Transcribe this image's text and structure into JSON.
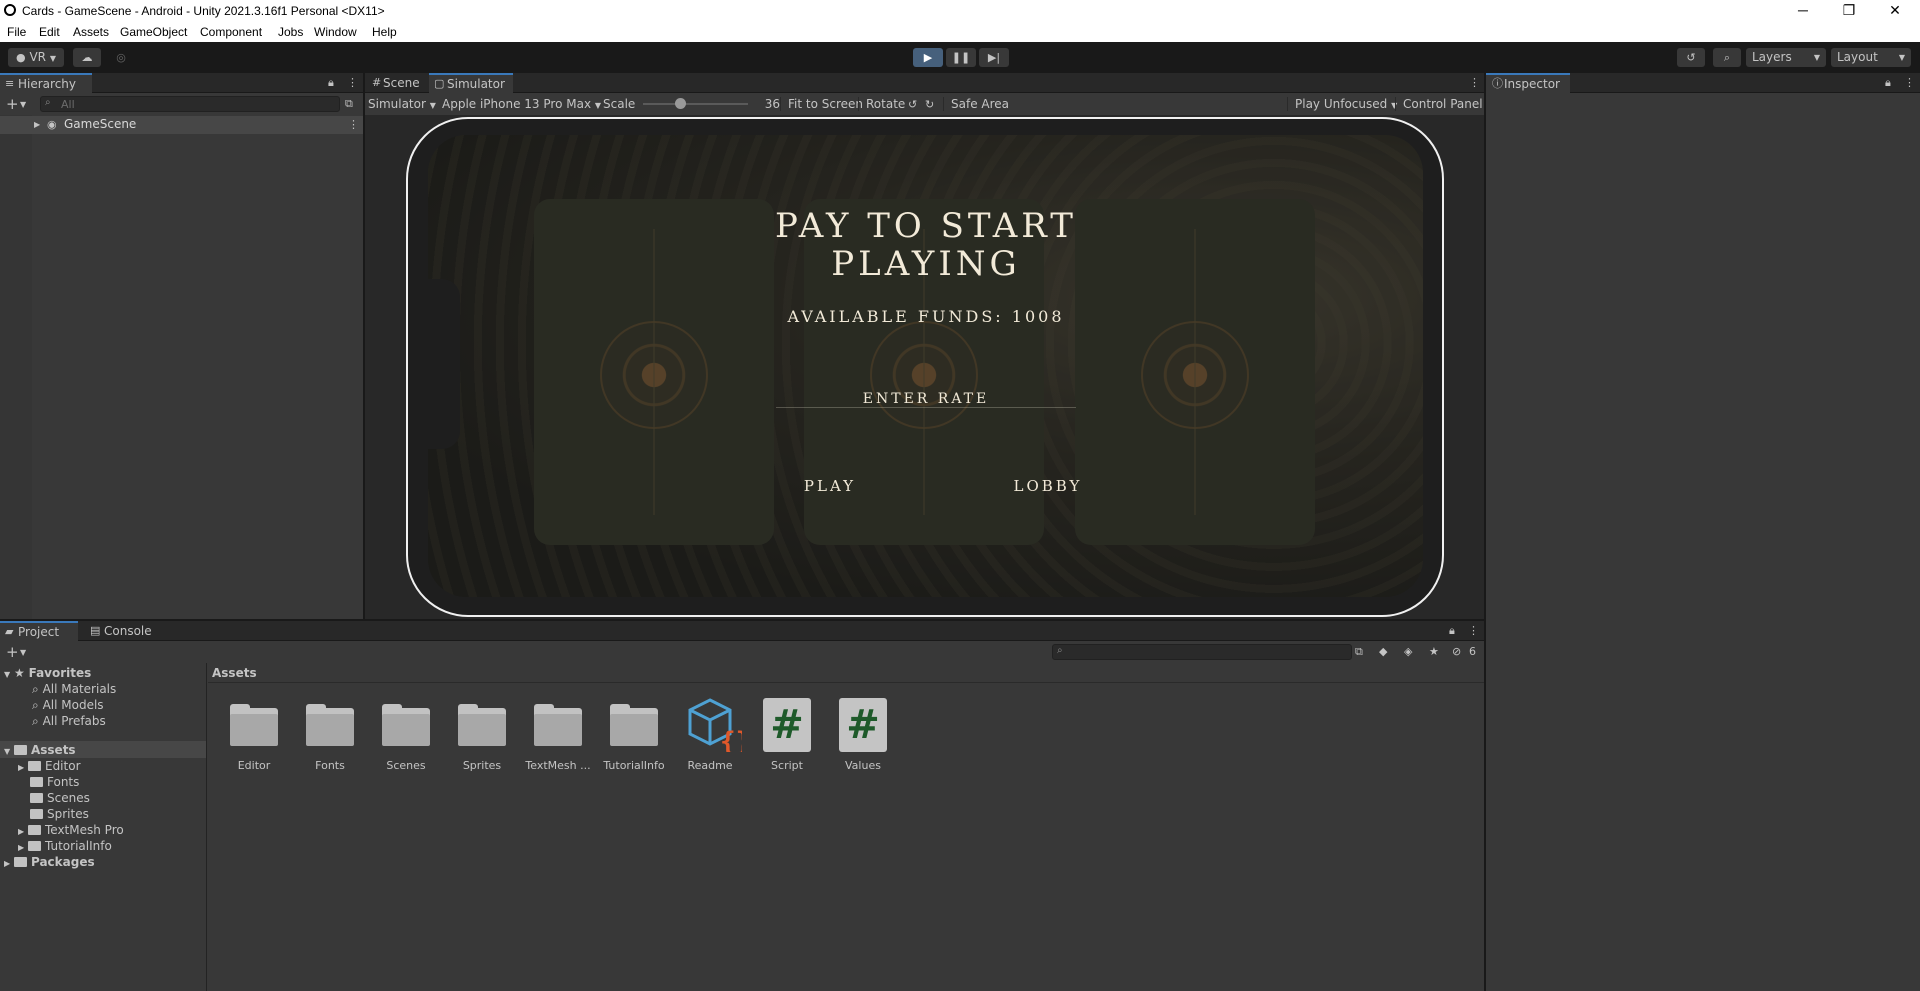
{
  "window": {
    "title": "Cards - GameScene - Android - Unity 2021.3.16f1 Personal <DX11>",
    "minimize": "─",
    "maximize": "❐",
    "close": "✕"
  },
  "menu": [
    "File",
    "Edit",
    "Assets",
    "GameObject",
    "Component",
    "Jobs",
    "Window",
    "Help"
  ],
  "toolbar": {
    "account": "VR",
    "layers": "Layers",
    "layout": "Layout"
  },
  "hierarchy": {
    "tab": "Hierarchy",
    "search_placeholder": "All",
    "scene": "GameScene"
  },
  "sceneview": {
    "tabs": [
      "Scene",
      "Simulator"
    ],
    "simulator_dropdown": "Simulator",
    "device": "Apple iPhone 13 Pro Max",
    "scale_label": "Scale",
    "scale_value": "36",
    "scale_fraction": 0.35,
    "fit": "Fit to Screen",
    "rotate": "Rotate",
    "safe_area": "Safe Area",
    "play_mode": "Play Unfocused",
    "control_panel": "Control Panel"
  },
  "game": {
    "title_line1": "PAY TO START",
    "title_line2": "PLAYING",
    "funds": "AVAILABLE FUNDS: 1008",
    "enter_rate": "ENTER RATE",
    "play": "PLAY",
    "lobby": "LOBBY"
  },
  "inspector": {
    "tab": "Inspector"
  },
  "project": {
    "tabs": [
      "Project",
      "Console"
    ],
    "hidden_count": "6",
    "favorites_label": "Favorites",
    "favorites": [
      "All Materials",
      "All Models",
      "All Prefabs"
    ],
    "assets_label": "Assets",
    "asset_folders": [
      "Editor",
      "Fonts",
      "Scenes",
      "Sprites",
      "TextMesh Pro",
      "TutorialInfo"
    ],
    "packages_label": "Packages",
    "breadcrumb": "Assets",
    "grid": [
      {
        "label": "Editor",
        "kind": "folder"
      },
      {
        "label": "Fonts",
        "kind": "folder"
      },
      {
        "label": "Scenes",
        "kind": "folder"
      },
      {
        "label": "Sprites",
        "kind": "folder"
      },
      {
        "label": "TextMesh ...",
        "kind": "folder"
      },
      {
        "label": "TutorialInfo",
        "kind": "folder"
      },
      {
        "label": "Readme",
        "kind": "readme"
      },
      {
        "label": "Script",
        "kind": "script"
      },
      {
        "label": "Values",
        "kind": "script"
      }
    ]
  },
  "colors": {
    "accent": "#3a79bb",
    "panel": "#383838",
    "header": "#282828",
    "dark": "#191919",
    "play_active": "#46607c"
  }
}
